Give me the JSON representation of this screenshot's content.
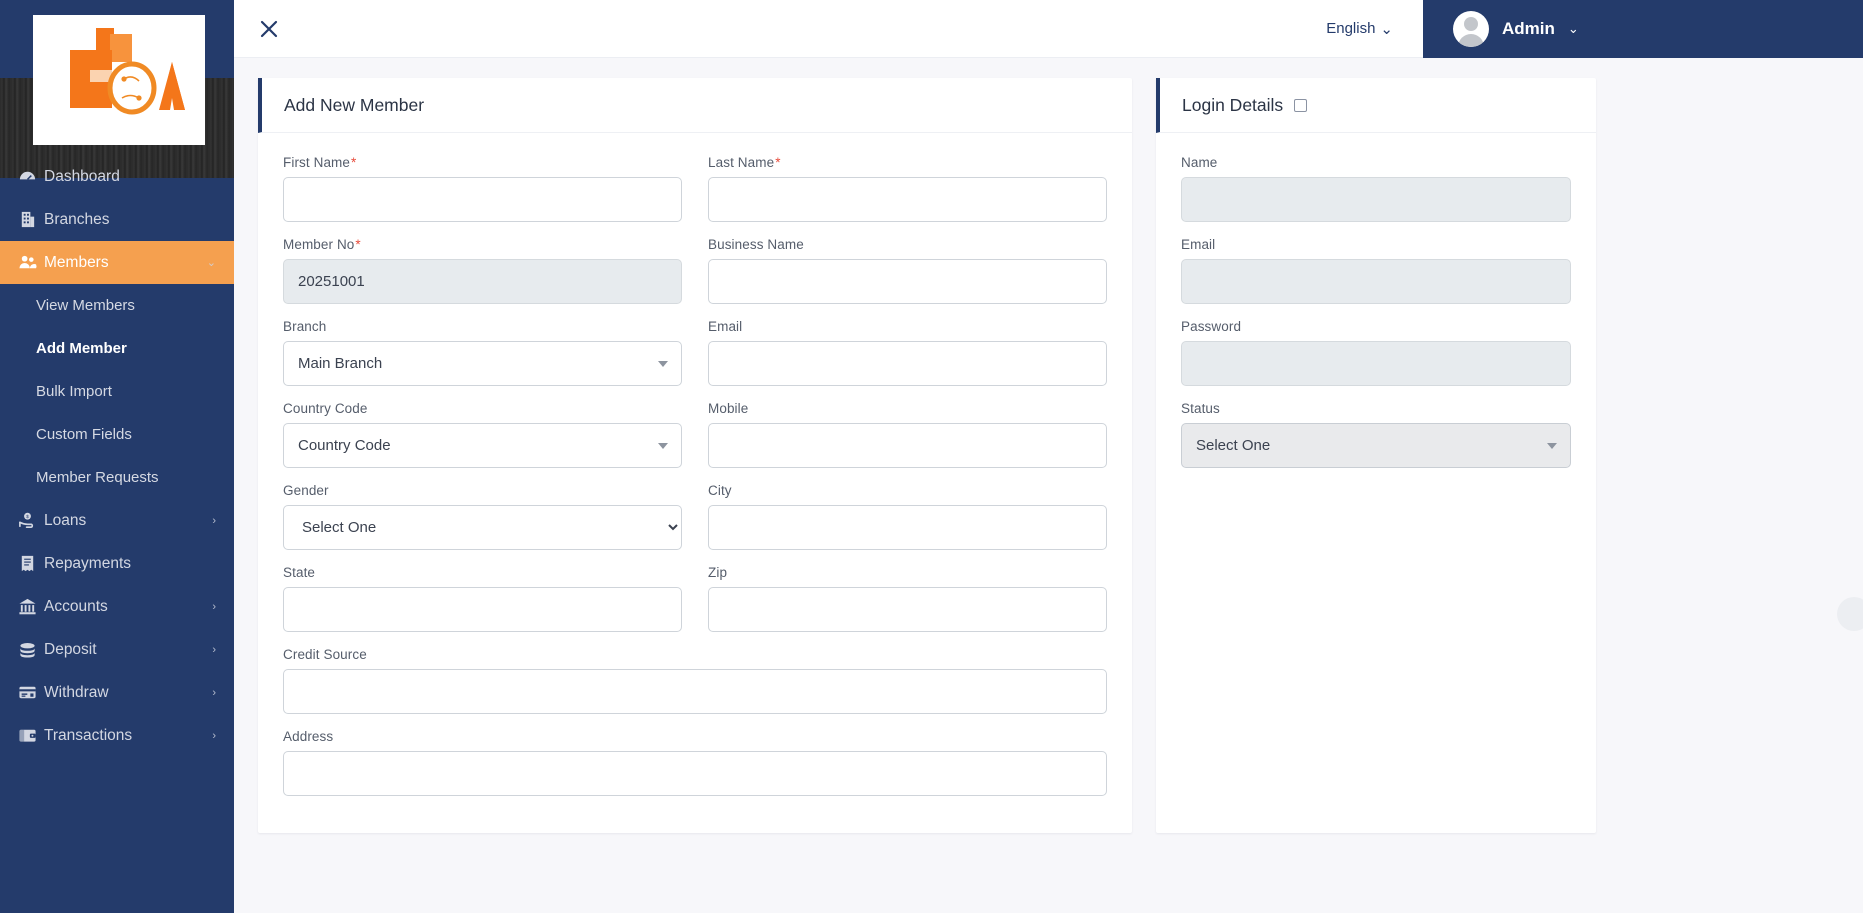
{
  "brand": {
    "logo_alt": "FOA"
  },
  "header": {
    "toggle_icon": "close-icon",
    "language": "English",
    "language_caret": "⌄",
    "profile_name": "Admin",
    "profile_caret": "⌄"
  },
  "sidebar": {
    "items": [
      {
        "label": "Dashboard",
        "icon": "dashboard-icon",
        "type": "item",
        "active": false,
        "caret": ""
      },
      {
        "label": "Branches",
        "icon": "building-icon",
        "type": "item",
        "active": false,
        "caret": ""
      },
      {
        "label": "Members",
        "icon": "users-icon",
        "type": "item",
        "active": true,
        "caret": "⌄"
      },
      {
        "label": "View Members",
        "type": "sub",
        "current": false
      },
      {
        "label": "Add Member",
        "type": "sub",
        "current": true
      },
      {
        "label": "Bulk Import",
        "type": "sub",
        "current": false
      },
      {
        "label": "Custom Fields",
        "type": "sub",
        "current": false
      },
      {
        "label": "Member Requests",
        "type": "sub",
        "current": false
      },
      {
        "label": "Loans",
        "icon": "hand-money-icon",
        "type": "item",
        "active": false,
        "caret": "›"
      },
      {
        "label": "Repayments",
        "icon": "receipt-icon",
        "type": "item",
        "active": false,
        "caret": ""
      },
      {
        "label": "Accounts",
        "icon": "bank-icon",
        "type": "item",
        "active": false,
        "caret": "›"
      },
      {
        "label": "Deposit",
        "icon": "coins-icon",
        "type": "item",
        "active": false,
        "caret": "›"
      },
      {
        "label": "Withdraw",
        "icon": "card-icon",
        "type": "item",
        "active": false,
        "caret": "›"
      },
      {
        "label": "Transactions",
        "icon": "wallet-icon",
        "type": "item",
        "active": false,
        "caret": "›"
      }
    ]
  },
  "member_card": {
    "title": "Add New Member",
    "fields": {
      "first_name": {
        "label": "First Name",
        "required": true,
        "value": "",
        "placeholder": ""
      },
      "last_name": {
        "label": "Last Name",
        "required": true,
        "value": "",
        "placeholder": ""
      },
      "member_no": {
        "label": "Member No",
        "required": true,
        "value": "20251001",
        "disabled": true
      },
      "business_name": {
        "label": "Business Name",
        "required": false,
        "value": "",
        "placeholder": ""
      },
      "branch": {
        "label": "Branch",
        "required": false,
        "value": "Main Branch"
      },
      "email": {
        "label": "Email",
        "required": false,
        "value": "",
        "placeholder": ""
      },
      "country_code": {
        "label": "Country Code",
        "required": false,
        "value": "Country Code"
      },
      "mobile": {
        "label": "Mobile",
        "required": false,
        "value": "",
        "placeholder": ""
      },
      "gender": {
        "label": "Gender",
        "required": false,
        "value": "Select One"
      },
      "city": {
        "label": "City",
        "required": false,
        "value": "",
        "placeholder": ""
      },
      "state": {
        "label": "State",
        "required": false,
        "value": "",
        "placeholder": ""
      },
      "zip": {
        "label": "Zip",
        "required": false,
        "value": "",
        "placeholder": ""
      },
      "credit_source": {
        "label": "Credit Source",
        "required": false,
        "value": "",
        "placeholder": ""
      },
      "address": {
        "label": "Address",
        "required": false,
        "value": "",
        "placeholder": ""
      }
    }
  },
  "login_card": {
    "title": "Login Details",
    "checkbox_checked": false,
    "fields": {
      "name": {
        "label": "Name",
        "value": "",
        "disabled": true
      },
      "email": {
        "label": "Email",
        "value": "",
        "disabled": true
      },
      "password": {
        "label": "Password",
        "value": "",
        "disabled": true
      },
      "status": {
        "label": "Status",
        "value": "Select One",
        "disabled": true
      }
    }
  },
  "colors": {
    "sidebar": "#243b6b",
    "accent_orange": "#f5a04f",
    "page_bg": "#f7f7fa",
    "required": "#e74c3c",
    "disabled_field": "#e7ebee"
  }
}
